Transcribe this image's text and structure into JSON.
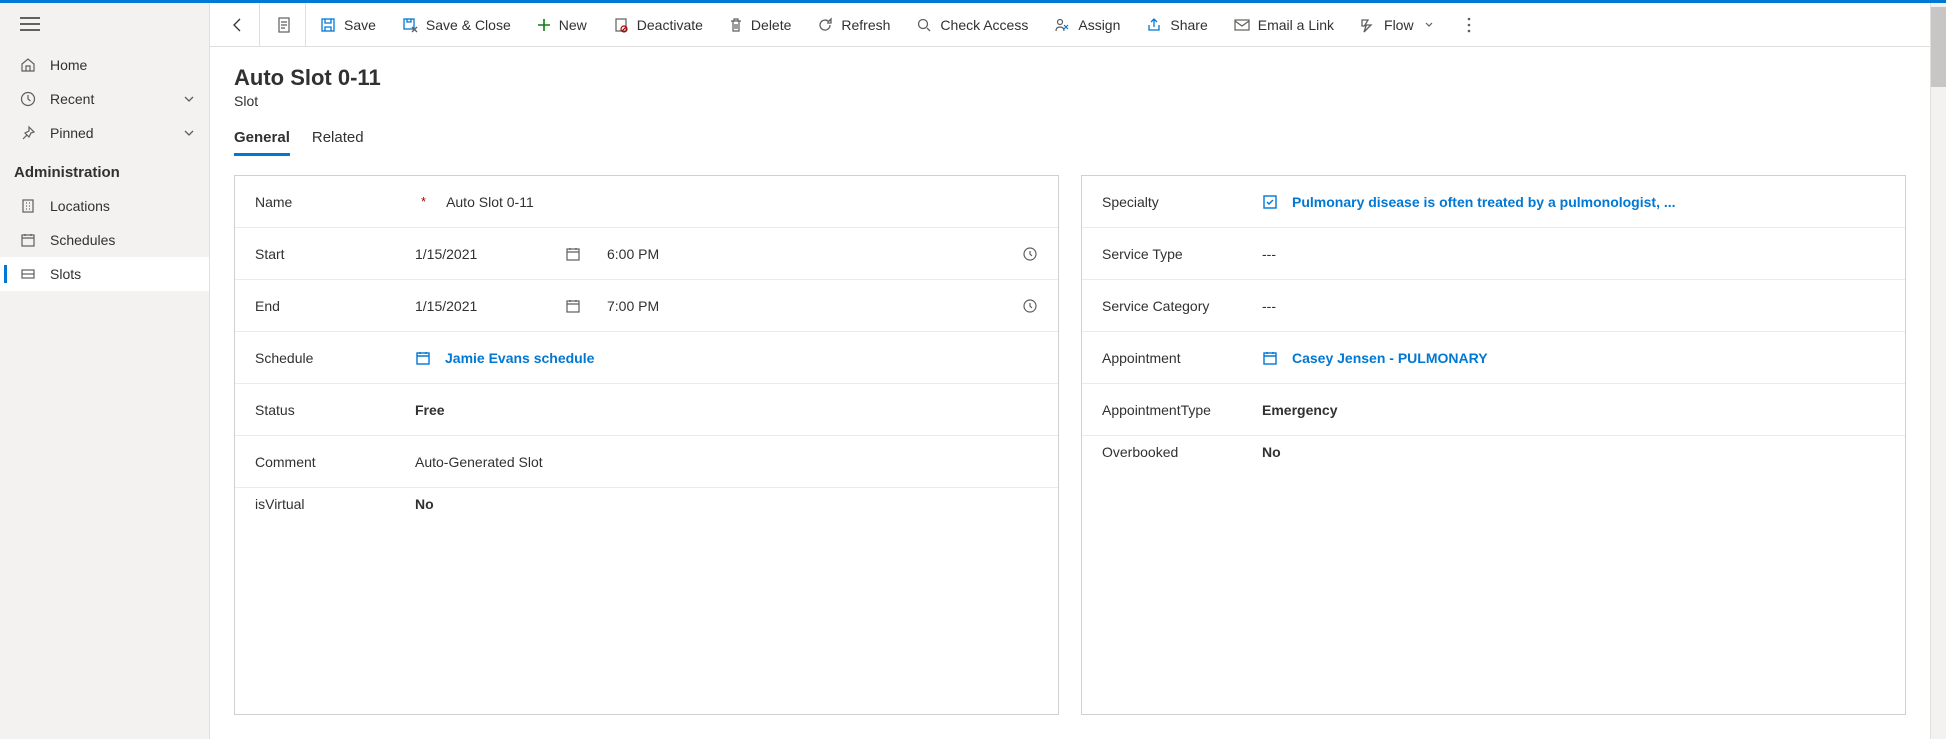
{
  "sidebar": {
    "system": [
      {
        "label": "Home",
        "icon": "home"
      },
      {
        "label": "Recent",
        "icon": "clock",
        "expandable": true
      },
      {
        "label": "Pinned",
        "icon": "pin",
        "expandable": true
      }
    ],
    "section_title": "Administration",
    "admin": [
      {
        "label": "Locations",
        "icon": "building"
      },
      {
        "label": "Schedules",
        "icon": "calendar"
      },
      {
        "label": "Slots",
        "icon": "slot",
        "active": true
      }
    ]
  },
  "commandbar": {
    "save": "Save",
    "save_close": "Save & Close",
    "new": "New",
    "deactivate": "Deactivate",
    "delete": "Delete",
    "refresh": "Refresh",
    "check_access": "Check Access",
    "assign": "Assign",
    "share": "Share",
    "email_link": "Email a Link",
    "flow": "Flow"
  },
  "header": {
    "title": "Auto Slot 0-11",
    "entity": "Slot"
  },
  "tabs": {
    "general": "General",
    "related": "Related"
  },
  "form_left": {
    "name_label": "Name",
    "name_value": "Auto Slot 0-11",
    "start_label": "Start",
    "start_date": "1/15/2021",
    "start_time": "6:00 PM",
    "end_label": "End",
    "end_date": "1/15/2021",
    "end_time": "7:00 PM",
    "schedule_label": "Schedule",
    "schedule_value": "Jamie Evans schedule",
    "status_label": "Status",
    "status_value": "Free",
    "comment_label": "Comment",
    "comment_value": "Auto-Generated Slot",
    "isvirtual_label": "isVirtual",
    "isvirtual_value": "No"
  },
  "form_right": {
    "specialty_label": "Specialty",
    "specialty_value": "Pulmonary disease is often treated by a pulmonologist, ...",
    "service_type_label": "Service Type",
    "service_type_value": "---",
    "service_category_label": "Service Category",
    "service_category_value": "---",
    "appointment_label": "Appointment",
    "appointment_value": "Casey Jensen - PULMONARY",
    "appointment_type_label": "AppointmentType",
    "appointment_type_value": "Emergency",
    "overbooked_label": "Overbooked",
    "overbooked_value": "No"
  }
}
